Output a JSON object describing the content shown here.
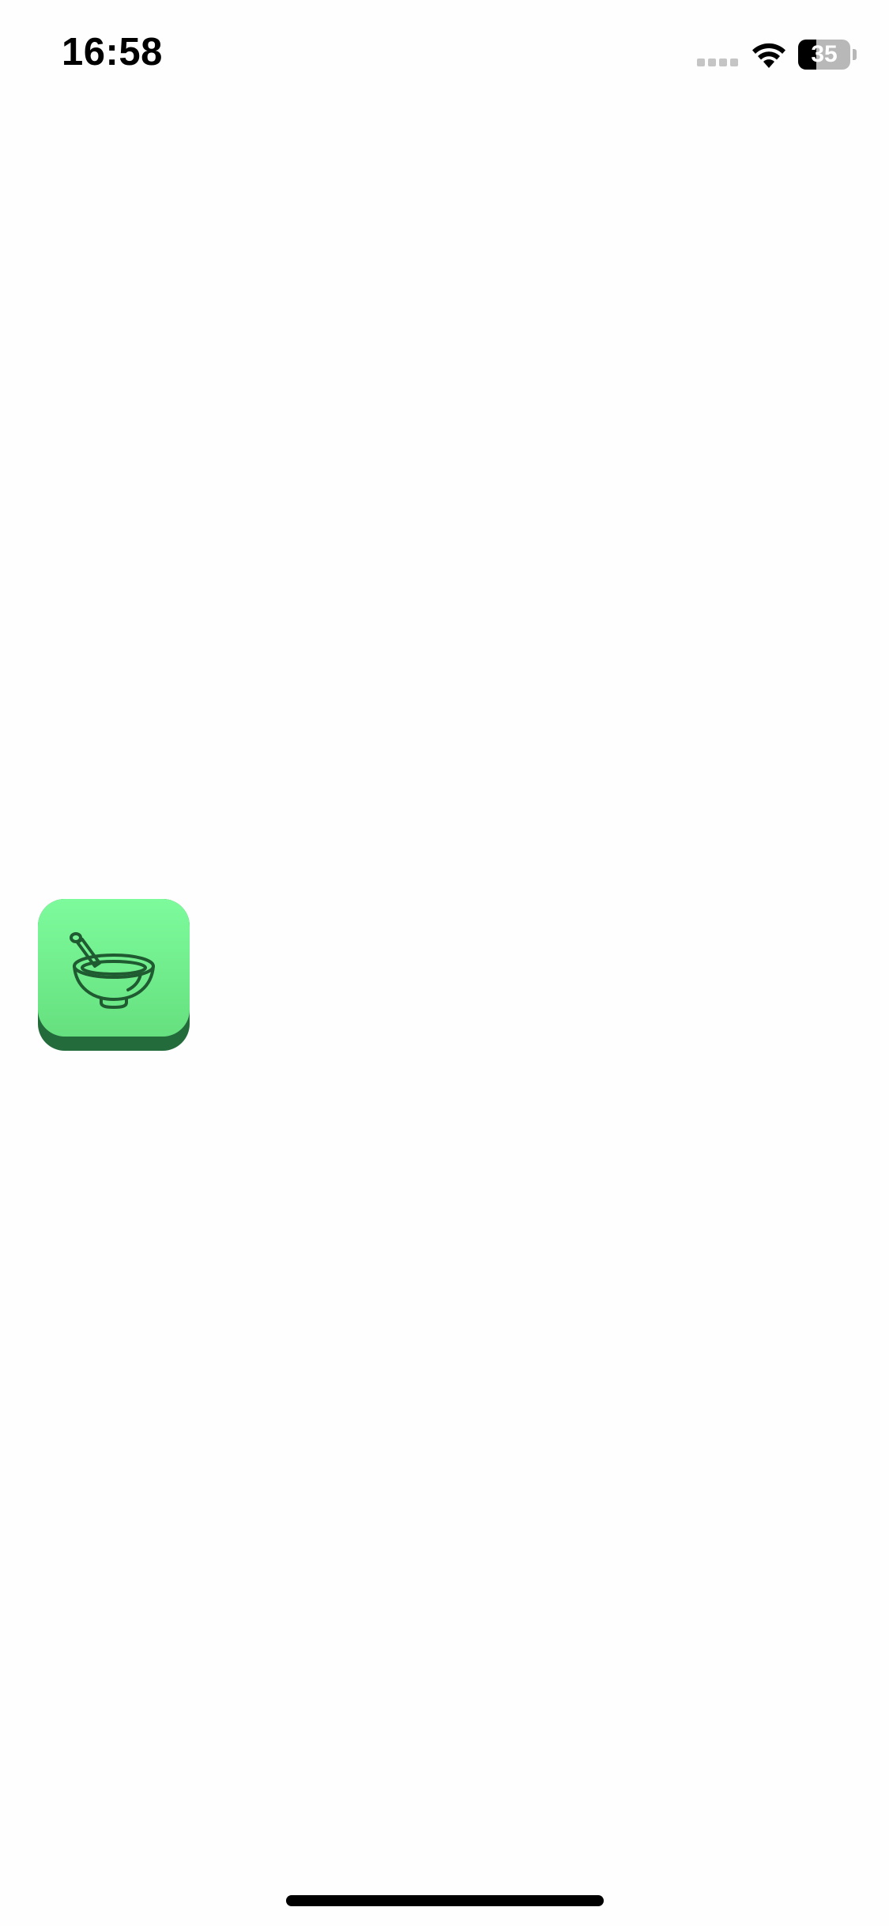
{
  "status_bar": {
    "time": "16:58",
    "battery_level": 35,
    "battery_label": "35",
    "signal_icon": "cellular-signal-icon",
    "wifi_icon": "wifi-icon",
    "battery_icon": "battery-icon"
  },
  "app_icon": {
    "icon": "mortar-and-pestle-icon",
    "accent_light": "#7dfb9c",
    "accent_dark": "#236b3a",
    "stroke": "#1f5a30"
  },
  "home_indicator": {
    "color": "#000000"
  }
}
